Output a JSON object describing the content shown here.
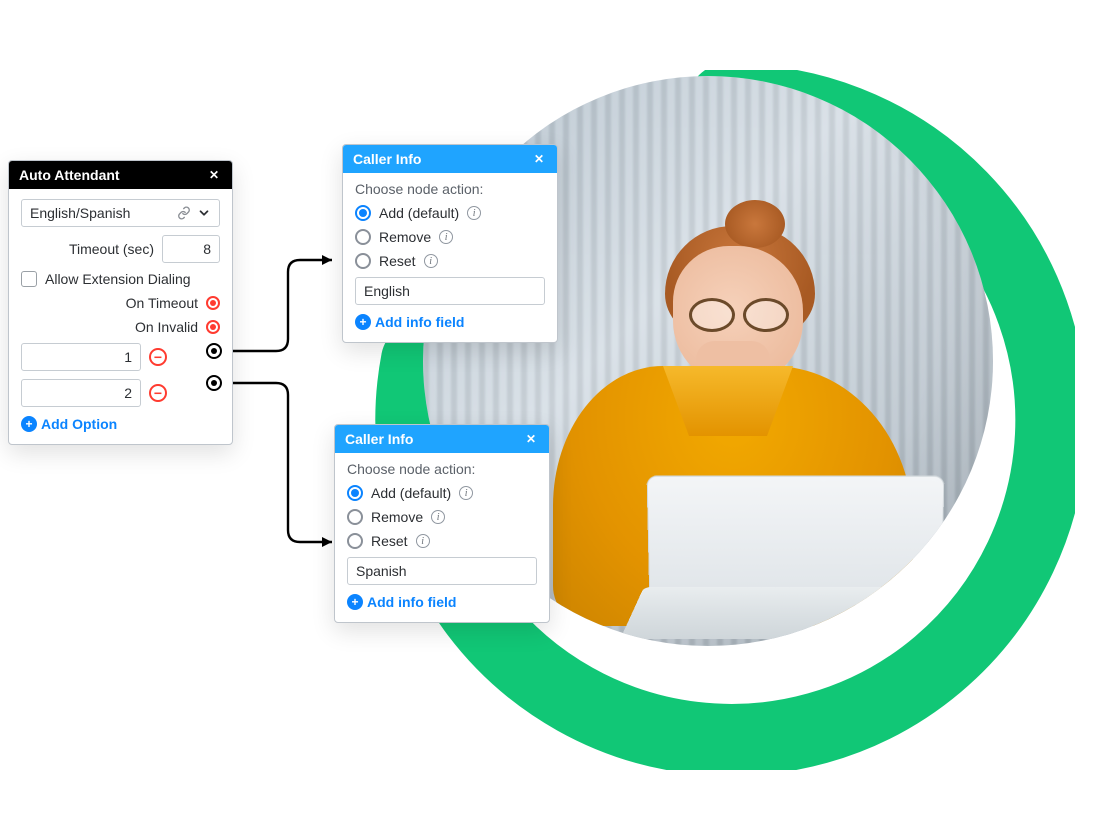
{
  "colors": {
    "accent_blue": "#0b84ff",
    "header_blue": "#1fa4ff",
    "danger_red": "#ff3b30",
    "brand_green": "#11c776"
  },
  "attendant": {
    "title": "Auto Attendant",
    "language_value": "English/Spanish",
    "timeout_label": "Timeout (sec)",
    "timeout_value": "8",
    "allow_ext_label": "Allow Extension Dialing",
    "on_timeout_label": "On Timeout",
    "on_invalid_label": "On Invalid",
    "options": [
      {
        "value": "1"
      },
      {
        "value": "2"
      }
    ],
    "add_option_label": "Add Option"
  },
  "caller_panels": [
    {
      "title": "Caller Info",
      "subtitle": "Choose node action:",
      "actions": [
        {
          "label": "Add (default)",
          "selected": true
        },
        {
          "label": "Remove",
          "selected": false
        },
        {
          "label": "Reset",
          "selected": false
        }
      ],
      "field_value": "English",
      "add_field_label": "Add info field"
    },
    {
      "title": "Caller Info",
      "subtitle": "Choose node action:",
      "actions": [
        {
          "label": "Add (default)",
          "selected": true
        },
        {
          "label": "Remove",
          "selected": false
        },
        {
          "label": "Reset",
          "selected": false
        }
      ],
      "field_value": "Spanish",
      "add_field_label": "Add info field"
    }
  ]
}
